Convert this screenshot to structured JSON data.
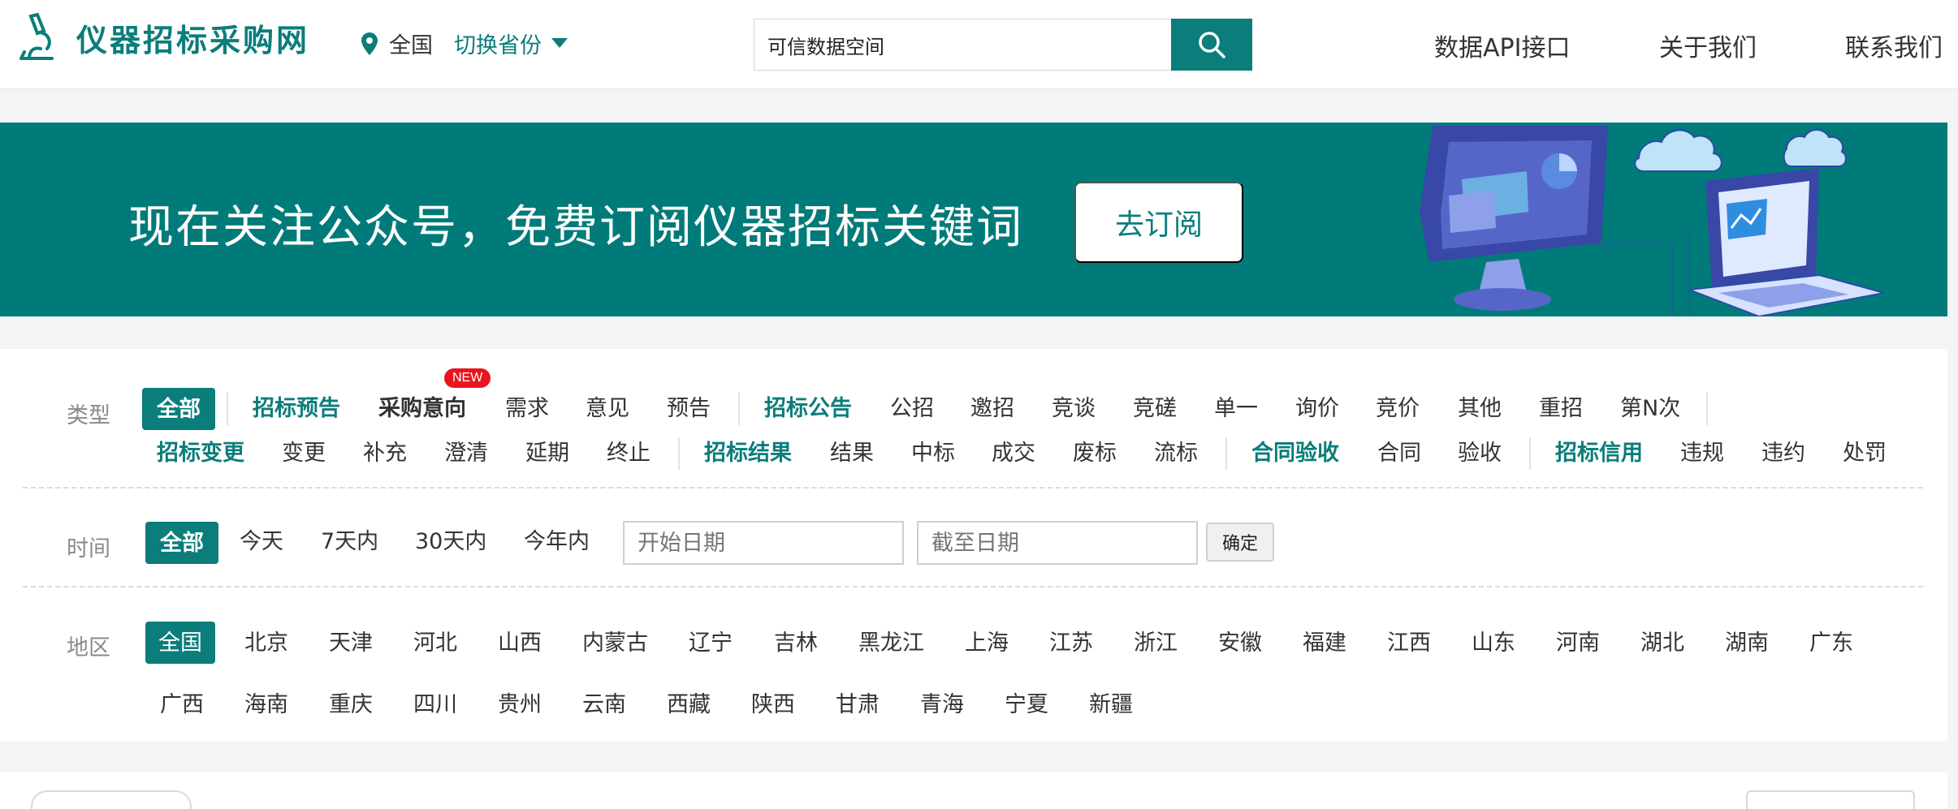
{
  "header": {
    "logo_text": "仪器招标采购网",
    "location": "全国",
    "switch_province": "切换省份",
    "search_value": "可信数据空间",
    "nav": [
      "数据API接口",
      "关于我们",
      "联系我们"
    ]
  },
  "banner": {
    "text": "现在关注公众号，免费订阅仪器招标关键词",
    "button": "去订阅"
  },
  "filters": {
    "type_label": "类型",
    "new_badge": "NEW",
    "type_row1": [
      "全部",
      "招标预告",
      "采购意向",
      "需求",
      "意见",
      "预告",
      "招标公告",
      "公招",
      "邀招",
      "竞谈",
      "竞磋",
      "单一",
      "询价",
      "竞价",
      "其他",
      "重招",
      "第N次"
    ],
    "type_row2": [
      "招标变更",
      "变更",
      "补充",
      "澄清",
      "延期",
      "终止",
      "招标结果",
      "结果",
      "中标",
      "成交",
      "废标",
      "流标",
      "合同验收",
      "合同",
      "验收",
      "招标信用",
      "违规",
      "违约",
      "处罚"
    ],
    "time_label": "时间",
    "time_options": [
      "全部",
      "今天",
      "7天内",
      "30天内",
      "今年内"
    ],
    "start_placeholder": "开始日期",
    "end_placeholder": "截至日期",
    "confirm": "确定",
    "region_label": "地区",
    "regions_row1": [
      "全国",
      "北京",
      "天津",
      "河北",
      "山西",
      "内蒙古",
      "辽宁",
      "吉林",
      "黑龙江",
      "上海",
      "江苏",
      "浙江",
      "安徽",
      "福建",
      "江西",
      "山东",
      "河南",
      "湖北",
      "湖南",
      "广东"
    ],
    "regions_row2": [
      "广西",
      "海南",
      "重庆",
      "四川",
      "贵州",
      "云南",
      "西藏",
      "陕西",
      "甘肃",
      "青海",
      "宁夏",
      "新疆"
    ]
  },
  "colors": {
    "brand": "#0b7d7b",
    "badge": "#e8151f"
  }
}
